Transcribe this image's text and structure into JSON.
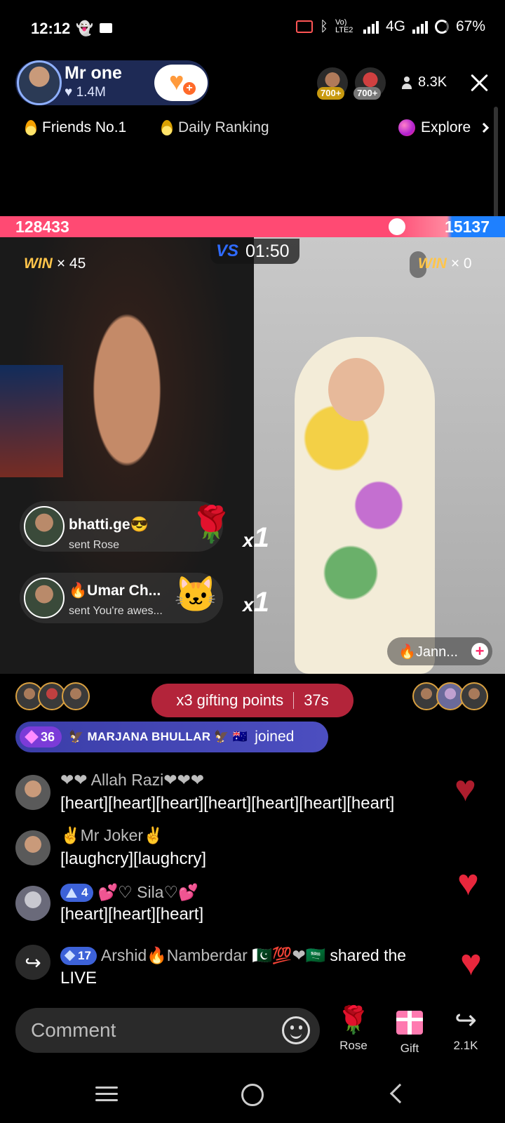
{
  "status_bar": {
    "time": "12:12",
    "network": "4G",
    "battery": "67%",
    "volte": "Vo) LTE2"
  },
  "host": {
    "name": "Mr one",
    "likes": "1.4M"
  },
  "top_viewers": [
    {
      "badge": "700+"
    },
    {
      "badge": "700+"
    }
  ],
  "viewer_count": "8.3K",
  "chips": {
    "friends": "Friends No.1",
    "daily": "Daily Ranking",
    "explore": "Explore"
  },
  "battle": {
    "left_score": "128433",
    "right_score": "15137",
    "timer": "01:50",
    "vs": "VS",
    "left_win_label": "WIN",
    "left_win_count": "× 45",
    "right_win_label": "WIN",
    "right_win_count": "× 0",
    "left_score_fraction": 0.895,
    "guest_name": "🔥Jann..."
  },
  "gift_notifications": [
    {
      "user": "bhatti.ge😎",
      "action": "sent Rose",
      "item": "🌹",
      "multiplier_x": "x",
      "multiplier_n": "1"
    },
    {
      "user": "🔥Umar Ch...",
      "action": "sent You're awes...",
      "item": "🐱",
      "multiplier_x": "x",
      "multiplier_n": "1"
    }
  ],
  "gifting": {
    "label": "x3 gifting points",
    "countdown": "37s"
  },
  "joined": {
    "level": "36",
    "name": "🦅 MARJANA BHULLAR 🦅 🇦🇺",
    "action": "joined"
  },
  "comments": [
    {
      "name": "❤❤ Allah Razi❤❤❤",
      "text": "[heart][heart][heart][heart][heart][heart][heart]"
    },
    {
      "name": "✌Mr Joker✌",
      "text": "[laughcry][laughcry]"
    },
    {
      "level": "4",
      "name": "💕♡ Sila♡💕",
      "text": "[heart][heart][heart]"
    }
  ],
  "share_event": {
    "level": "17",
    "name": "Arshid🔥Namberdar 🇵🇰💯❤🇸🇦",
    "text_a": "shared the",
    "text_b": "LIVE"
  },
  "bottom": {
    "comment_placeholder": "Comment",
    "rose_label": "Rose",
    "gift_label": "Gift",
    "share_count": "2.1K"
  },
  "colors": {
    "red_side": "#ff4a73",
    "blue_side": "#1e80ff",
    "gifting_pill": "#b3243a",
    "joined_bar": "#3b3ea8"
  }
}
